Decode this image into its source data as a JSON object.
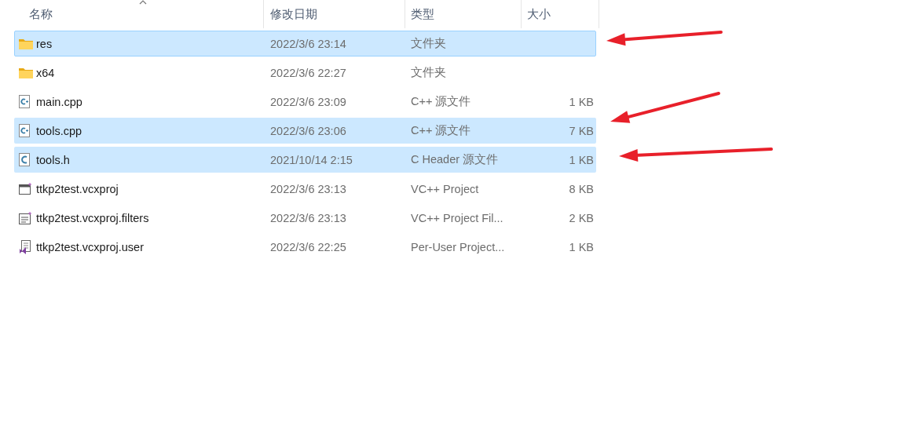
{
  "columns": [
    {
      "label": "名称",
      "sorted": true
    },
    {
      "label": "修改日期",
      "sorted": false
    },
    {
      "label": "类型",
      "sorted": false
    },
    {
      "label": "大小",
      "sorted": false
    }
  ],
  "files": [
    {
      "kind": "folder",
      "name": "res",
      "modified": "2022/3/6 23:14",
      "type": "文件夹",
      "selected": true,
      "focused": true
    },
    {
      "kind": "folder",
      "name": "x64",
      "modified": "2022/3/6 22:27",
      "type": "文件夹",
      "selected": false,
      "focused": false
    },
    {
      "kind": "cpp",
      "name": "main.cpp",
      "modified": "2022/3/6 23:09",
      "type": "C++ 源文件",
      "size": "1 KB",
      "selected": false,
      "focused": false
    },
    {
      "kind": "cpp",
      "name": "tools.cpp",
      "modified": "2022/3/6 23:06",
      "type": "C++ 源文件",
      "size": "7 KB",
      "selected": true,
      "focused": false
    },
    {
      "kind": "header",
      "name": "tools.h",
      "modified": "2021/10/14 2:15",
      "type": "C Header 源文件",
      "size": "1 KB",
      "selected": true,
      "focused": false
    },
    {
      "kind": "project",
      "name": "ttkp2test.vcxproj",
      "modified": "2022/3/6 23:13",
      "type": "VC++ Project",
      "size": "8 KB",
      "selected": false,
      "focused": false
    },
    {
      "kind": "filters",
      "name": "ttkp2test.vcxproj.filters",
      "modified": "2022/3/6 23:13",
      "type": "VC++ Project Fil...",
      "size": "2 KB",
      "selected": false,
      "focused": false
    },
    {
      "kind": "user",
      "name": "ttkp2test.vcxproj.user",
      "modified": "2022/3/6 22:25",
      "type": "Per-User Project...",
      "size": "1 KB",
      "selected": false,
      "focused": false
    }
  ]
}
